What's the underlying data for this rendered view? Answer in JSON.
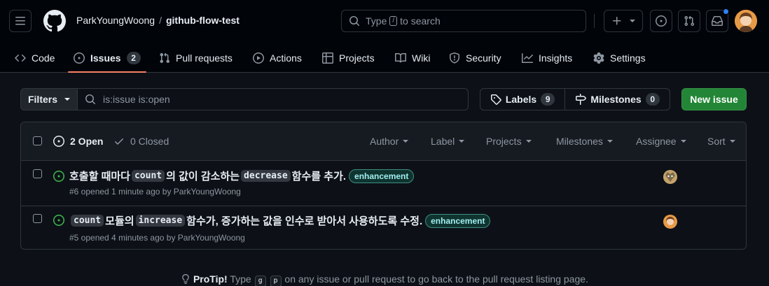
{
  "header": {
    "owner": "ParkYoungWoong",
    "separator": "/",
    "repo": "github-flow-test",
    "search": {
      "prefix": "Type",
      "key": "/",
      "suffix": "to search"
    }
  },
  "nav": {
    "tabs": [
      {
        "label": "Code",
        "icon": "code-icon"
      },
      {
        "label": "Issues",
        "icon": "issue-opened-icon",
        "count": "2",
        "selected": true
      },
      {
        "label": "Pull requests",
        "icon": "git-pull-request-icon"
      },
      {
        "label": "Actions",
        "icon": "play-icon"
      },
      {
        "label": "Projects",
        "icon": "table-icon"
      },
      {
        "label": "Wiki",
        "icon": "book-icon"
      },
      {
        "label": "Security",
        "icon": "shield-icon"
      },
      {
        "label": "Insights",
        "icon": "graph-icon"
      },
      {
        "label": "Settings",
        "icon": "gear-icon"
      }
    ]
  },
  "toolbar": {
    "filters_label": "Filters",
    "query": "is:issue is:open",
    "labels_label": "Labels",
    "labels_count": "9",
    "milestones_label": "Milestones",
    "milestones_count": "0",
    "new_issue_label": "New issue"
  },
  "list_header": {
    "open_label": "2 Open",
    "closed_label": "0 Closed",
    "filters": [
      "Author",
      "Label",
      "Projects",
      "Milestones",
      "Assignee",
      "Sort"
    ]
  },
  "issues": [
    {
      "title_parts": [
        {
          "text": "호출할 때마다 ",
          "code": false
        },
        {
          "text": "count",
          "code": true
        },
        {
          "text": "의 값이 감소하는 ",
          "code": false
        },
        {
          "text": "decrease",
          "code": true
        },
        {
          "text": " 함수를 추가.",
          "code": false
        }
      ],
      "label": "enhancement",
      "meta": "#6 opened 1 minute ago by ParkYoungWoong"
    },
    {
      "title_parts": [
        {
          "text": "count",
          "code": true
        },
        {
          "text": " 모듈의 ",
          "code": false
        },
        {
          "text": "increase",
          "code": true
        },
        {
          "text": " 함수가, 증가하는 값을 인수로 받아서 사용하도록 수정.",
          "code": false
        }
      ],
      "label": "enhancement",
      "meta": "#5 opened 4 minutes ago by ParkYoungWoong"
    }
  ],
  "protip": {
    "lead": "ProTip!",
    "before": " Type ",
    "key1": "g",
    "key2": "p",
    "after": " on any issue or pull request to go back to the pull request listing page."
  },
  "colors": {
    "accent": "#f78166",
    "open": "#3fb950",
    "primary": "#238636",
    "label_text": "#a2eeef"
  }
}
